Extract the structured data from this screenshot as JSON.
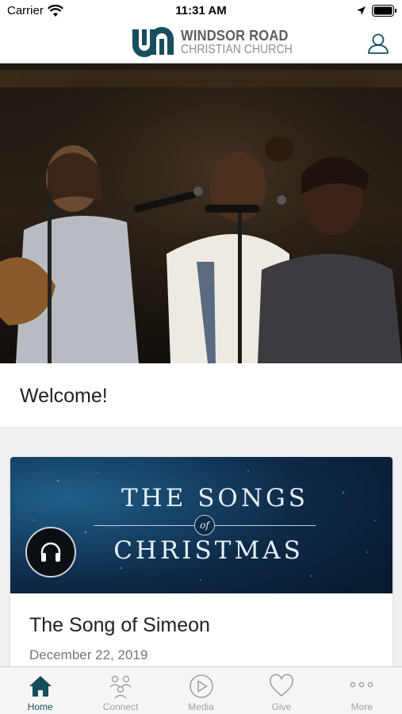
{
  "status_bar": {
    "carrier": "Carrier",
    "time": "11:31 AM"
  },
  "header": {
    "logo_line1": "WINDSOR ROAD",
    "logo_line2": "CHRISTIAN CHURCH",
    "brand_color": "#164e5e"
  },
  "welcome": {
    "title": "Welcome!"
  },
  "card": {
    "banner_title_line1": "THE SONGS",
    "banner_of": "of",
    "banner_title_line2": "CHRISTMAS",
    "title": "The Song of Simeon",
    "date": "December 22, 2019",
    "media_icon": "headphones-icon"
  },
  "tabs": [
    {
      "label": "Home",
      "icon": "home-icon",
      "active": true
    },
    {
      "label": "Connect",
      "icon": "people-icon",
      "active": false
    },
    {
      "label": "Media",
      "icon": "play-icon",
      "active": false
    },
    {
      "label": "Give",
      "icon": "heart-icon",
      "active": false
    },
    {
      "label": "More",
      "icon": "more-icon",
      "active": false
    }
  ]
}
